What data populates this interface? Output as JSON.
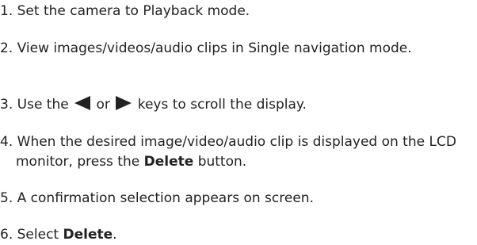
{
  "steps": [
    {
      "number": "1.",
      "text": "Set the camera to Playback mode."
    },
    {
      "number": "2.",
      "text": "View images/videos/audio clips in Single navigation mode."
    },
    {
      "number": "3.",
      "text_before": "Use the",
      "text_middle": "or",
      "text_after": "keys to scroll the display.",
      "icons": [
        "left-arrow-icon",
        "right-arrow-icon"
      ]
    },
    {
      "number": "4.",
      "text_before": "When the desired image/video/audio clip is displayed on the LCD monitor, press the",
      "bold": "Delete",
      "text_after": "button."
    },
    {
      "number": "5.",
      "text": "A confirmation selection appears on screen."
    },
    {
      "number": "6.",
      "text_before": "Select",
      "bold": "Delete",
      "text_after": "."
    }
  ]
}
